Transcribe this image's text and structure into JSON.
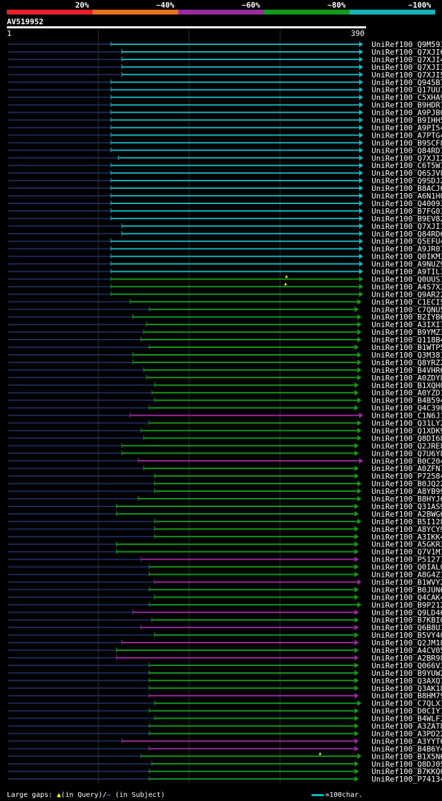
{
  "identity_scale": {
    "bins": [
      {
        "label": "20%",
        "color": "#e8202a"
      },
      {
        "label": "~40%",
        "color": "#e8721c"
      },
      {
        "label": "~60%",
        "color": "#9a2aa0"
      },
      {
        "label": "~80%",
        "color": "#149a1a"
      },
      {
        "label": "~100%",
        "color": "#16b4bc"
      }
    ]
  },
  "query": {
    "id": "AV519952",
    "start_label": "1",
    "end_label": "390",
    "length": 390
  },
  "legend": {
    "prefix": "Large gaps:",
    "query_marker": "▲",
    "in_query": "(in Query)/",
    "subject_marker": "—",
    "in_subject": " (in Subject)",
    "unit": "=100char."
  },
  "chart_data": {
    "type": "alignment",
    "x_axis": {
      "min": 1,
      "max": 390
    },
    "hits": [
      {
        "name": "UniRef100_Q9M591",
        "start": 114,
        "end": 390,
        "color": "#16b4bc"
      },
      {
        "name": "UniRef100_Q7XJI6",
        "start": 126,
        "end": 390,
        "color": "#16b4bc"
      },
      {
        "name": "UniRef100_Q7XJI4",
        "start": 126,
        "end": 390,
        "color": "#16b4bc"
      },
      {
        "name": "UniRef100_Q7XJI3",
        "start": 126,
        "end": 390,
        "color": "#16b4bc"
      },
      {
        "name": "UniRef100_Q7XJI5",
        "start": 126,
        "end": 390,
        "color": "#16b4bc"
      },
      {
        "name": "UniRef100_Q945B7",
        "start": 114,
        "end": 390,
        "color": "#16b4bc"
      },
      {
        "name": "UniRef100_Q17UU7",
        "start": 114,
        "end": 390,
        "color": "#16b4bc"
      },
      {
        "name": "UniRef100_C5XHA9",
        "start": 114,
        "end": 390,
        "color": "#16b4bc"
      },
      {
        "name": "UniRef100_B9HDR7",
        "start": 114,
        "end": 390,
        "color": "#16b4bc"
      },
      {
        "name": "UniRef100_A9PJB0",
        "start": 114,
        "end": 390,
        "color": "#16b4bc"
      },
      {
        "name": "UniRef100_B9IHH5",
        "start": 114,
        "end": 390,
        "color": "#16b4bc"
      },
      {
        "name": "UniRef100_A9PI54",
        "start": 114,
        "end": 390,
        "color": "#16b4bc"
      },
      {
        "name": "UniRef100_A7PTG4",
        "start": 114,
        "end": 390,
        "color": "#16b4bc"
      },
      {
        "name": "UniRef100_B9SCF8",
        "start": 114,
        "end": 390,
        "color": "#16b4bc"
      },
      {
        "name": "UniRef100_Q84RD7",
        "start": 114,
        "end": 390,
        "color": "#16b4bc"
      },
      {
        "name": "UniRef100_Q7XJI2",
        "start": 122,
        "end": 390,
        "color": "#16b4bc"
      },
      {
        "name": "UniRef100_C6T5W1",
        "start": 114,
        "end": 390,
        "color": "#16b4bc"
      },
      {
        "name": "UniRef100_Q6SJV8",
        "start": 114,
        "end": 390,
        "color": "#16b4bc"
      },
      {
        "name": "UniRef100_Q9SDJ2",
        "start": 114,
        "end": 390,
        "color": "#16b4bc"
      },
      {
        "name": "UniRef100_B8ACJ6",
        "start": 114,
        "end": 390,
        "color": "#16b4bc"
      },
      {
        "name": "UniRef100_A6N1H0",
        "start": 114,
        "end": 390,
        "color": "#16b4bc"
      },
      {
        "name": "UniRef100_Q40093",
        "start": 114,
        "end": 390,
        "color": "#16b4bc"
      },
      {
        "name": "UniRef100_B7FG03",
        "start": 114,
        "end": 390,
        "color": "#16b4bc"
      },
      {
        "name": "UniRef100_B9EV82",
        "start": 114,
        "end": 390,
        "color": "#16b4bc"
      },
      {
        "name": "UniRef100_Q7XJI1",
        "start": 126,
        "end": 390,
        "color": "#16b4bc"
      },
      {
        "name": "UniRef100_Q84RD6",
        "start": 126,
        "end": 390,
        "color": "#16b4bc"
      },
      {
        "name": "UniRef100_Q5EFU4",
        "start": 114,
        "end": 390,
        "color": "#16b4bc"
      },
      {
        "name": "UniRef100_A9JR07",
        "start": 114,
        "end": 390,
        "color": "#16b4bc"
      },
      {
        "name": "UniRef100_Q0IKM3",
        "start": 114,
        "end": 390,
        "color": "#16b4bc"
      },
      {
        "name": "UniRef100_A9NUZ9",
        "start": 114,
        "end": 390,
        "color": "#16b4bc"
      },
      {
        "name": "UniRef100_A9TIL3",
        "start": 114,
        "end": 390,
        "color": "#16b4bc"
      },
      {
        "name": "UniRef100_Q0UUS7",
        "start": 114,
        "end": 390,
        "color": "#149a1a"
      },
      {
        "name": "UniRef100_A4S7X3",
        "start": 114,
        "end": 390,
        "color": "#149a1a"
      },
      {
        "name": "UniRef100_Q9AR22",
        "start": 114,
        "end": 390,
        "color": "#149a1a"
      },
      {
        "name": "UniRef100_C1ECI5",
        "start": 135,
        "end": 388,
        "color": "#149a1a"
      },
      {
        "name": "UniRef100_C7QNU5",
        "start": 156,
        "end": 385,
        "color": "#149a1a"
      },
      {
        "name": "UniRef100_B2IYB6",
        "start": 138,
        "end": 388,
        "color": "#149a1a"
      },
      {
        "name": "UniRef100_A3IXI7",
        "start": 153,
        "end": 388,
        "color": "#149a1a"
      },
      {
        "name": "UniRef100_B9YMZ3",
        "start": 150,
        "end": 388,
        "color": "#149a1a"
      },
      {
        "name": "UniRef100_Q118B4",
        "start": 147,
        "end": 388,
        "color": "#149a1a"
      },
      {
        "name": "UniRef100_B1WTP5",
        "start": 156,
        "end": 385,
        "color": "#149a1a"
      },
      {
        "name": "UniRef100_Q3M381",
        "start": 138,
        "end": 388,
        "color": "#149a1a"
      },
      {
        "name": "UniRef100_Q8YRZ2",
        "start": 138,
        "end": 388,
        "color": "#149a1a"
      },
      {
        "name": "UniRef100_B4VHR6",
        "start": 150,
        "end": 388,
        "color": "#149a1a"
      },
      {
        "name": "UniRef100_A0ZDY8",
        "start": 153,
        "end": 388,
        "color": "#149a1a"
      },
      {
        "name": "UniRef100_B1XQH0",
        "start": 162,
        "end": 385,
        "color": "#149a1a"
      },
      {
        "name": "UniRef100_A0YZD1",
        "start": 159,
        "end": 385,
        "color": "#149a1a"
      },
      {
        "name": "UniRef100_B4B594",
        "start": 162,
        "end": 388,
        "color": "#149a1a"
      },
      {
        "name": "UniRef100_Q4C390",
        "start": 156,
        "end": 385,
        "color": "#149a1a"
      },
      {
        "name": "UniRef100_C1N6J1",
        "start": 135,
        "end": 390,
        "color": "#9a2aa0"
      },
      {
        "name": "UniRef100_Q31LY2",
        "start": 156,
        "end": 388,
        "color": "#149a1a"
      },
      {
        "name": "UniRef100_Q1XDK9",
        "start": 147,
        "end": 388,
        "color": "#149a1a"
      },
      {
        "name": "UniRef100_Q8DI68",
        "start": 150,
        "end": 388,
        "color": "#149a1a"
      },
      {
        "name": "UniRef100_Q2JRE8",
        "start": 126,
        "end": 385,
        "color": "#149a1a"
      },
      {
        "name": "UniRef100_Q7U6Y8",
        "start": 126,
        "end": 385,
        "color": "#149a1a"
      },
      {
        "name": "UniRef100_B0C204",
        "start": 144,
        "end": 390,
        "color": "#9a2aa0"
      },
      {
        "name": "UniRef100_A0ZFN7",
        "start": 150,
        "end": 385,
        "color": "#149a1a"
      },
      {
        "name": "UniRef100_P72584",
        "start": 162,
        "end": 385,
        "color": "#149a1a"
      },
      {
        "name": "UniRef100_B0JQ22",
        "start": 162,
        "end": 388,
        "color": "#149a1a"
      },
      {
        "name": "UniRef100_A8YB99",
        "start": 162,
        "end": 388,
        "color": "#149a1a"
      },
      {
        "name": "UniRef100_B8HYJ6",
        "start": 144,
        "end": 388,
        "color": "#149a1a"
      },
      {
        "name": "UniRef100_Q31AS9",
        "start": 120,
        "end": 385,
        "color": "#149a1a"
      },
      {
        "name": "UniRef100_A2BWG6",
        "start": 120,
        "end": 385,
        "color": "#149a1a"
      },
      {
        "name": "UniRef100_B5I128",
        "start": 162,
        "end": 388,
        "color": "#149a1a"
      },
      {
        "name": "UniRef100_A8YCY9",
        "start": 162,
        "end": 385,
        "color": "#149a1a"
      },
      {
        "name": "UniRef100_A3IKK4",
        "start": 162,
        "end": 385,
        "color": "#149a1a"
      },
      {
        "name": "UniRef100_A5GKR3",
        "start": 120,
        "end": 385,
        "color": "#149a1a"
      },
      {
        "name": "UniRef100_Q7V1M1",
        "start": 120,
        "end": 385,
        "color": "#149a1a"
      },
      {
        "name": "UniRef100_P51277",
        "start": 147,
        "end": 385,
        "color": "#9a2aa0"
      },
      {
        "name": "UniRef100_Q0IAL0",
        "start": 156,
        "end": 385,
        "color": "#149a1a"
      },
      {
        "name": "UniRef100_A8G4Z1",
        "start": 156,
        "end": 385,
        "color": "#149a1a"
      },
      {
        "name": "UniRef100_B1WVY2",
        "start": 162,
        "end": 388,
        "color": "#9a2aa0"
      },
      {
        "name": "UniRef100_B0JUN6",
        "start": 156,
        "end": 385,
        "color": "#149a1a"
      },
      {
        "name": "UniRef100_Q4CAK4",
        "start": 162,
        "end": 385,
        "color": "#149a1a"
      },
      {
        "name": "UniRef100_B9P212",
        "start": 156,
        "end": 388,
        "color": "#149a1a"
      },
      {
        "name": "UniRef100_Q9LD46",
        "start": 138,
        "end": 385,
        "color": "#9a2aa0"
      },
      {
        "name": "UniRef100_B7KBI0",
        "start": 159,
        "end": 385,
        "color": "#149a1a"
      },
      {
        "name": "UniRef100_Q6B8U1",
        "start": 147,
        "end": 385,
        "color": "#9a2aa0"
      },
      {
        "name": "UniRef100_B5VY40",
        "start": 162,
        "end": 385,
        "color": "#149a1a"
      },
      {
        "name": "UniRef100_Q2JM18",
        "start": 126,
        "end": 385,
        "color": "#9a2aa0"
      },
      {
        "name": "UniRef100_A4CV05",
        "start": 120,
        "end": 385,
        "color": "#149a1a"
      },
      {
        "name": "UniRef100_A2BR98",
        "start": 120,
        "end": 385,
        "color": "#9a2aa0"
      },
      {
        "name": "UniRef100_Q066V3",
        "start": 156,
        "end": 385,
        "color": "#149a1a"
      },
      {
        "name": "UniRef100_B9YUW2",
        "start": 156,
        "end": 385,
        "color": "#149a1a"
      },
      {
        "name": "UniRef100_Q3AXQ7",
        "start": 156,
        "end": 385,
        "color": "#149a1a"
      },
      {
        "name": "UniRef100_Q3AK18",
        "start": 156,
        "end": 385,
        "color": "#149a1a"
      },
      {
        "name": "UniRef100_B8HM79",
        "start": 156,
        "end": 385,
        "color": "#9a2aa0"
      },
      {
        "name": "UniRef100_C7QLX1",
        "start": 162,
        "end": 388,
        "color": "#149a1a"
      },
      {
        "name": "UniRef100_D0CIY7",
        "start": 156,
        "end": 385,
        "color": "#149a1a"
      },
      {
        "name": "UniRef100_B4WLF3",
        "start": 162,
        "end": 385,
        "color": "#149a1a"
      },
      {
        "name": "UniRef100_A3ZAT8",
        "start": 156,
        "end": 385,
        "color": "#149a1a"
      },
      {
        "name": "UniRef100_A3PD22",
        "start": 156,
        "end": 385,
        "color": "#149a1a"
      },
      {
        "name": "UniRef100_A3YYT6",
        "start": 126,
        "end": 385,
        "color": "#9a2aa0"
      },
      {
        "name": "UniRef100_B4B6Y4",
        "start": 156,
        "end": 385,
        "color": "#9a2aa0"
      },
      {
        "name": "UniRef100_B1X5N6",
        "start": 147,
        "end": 388,
        "color": "#149a1a"
      },
      {
        "name": "UniRef100_Q8DJ05",
        "start": 159,
        "end": 385,
        "color": "#149a1a"
      },
      {
        "name": "UniRef100_B7KKQ0",
        "start": 156,
        "end": 385,
        "color": "#149a1a"
      },
      {
        "name": "UniRef100_P74134",
        "start": 156,
        "end": 385,
        "color": "#149a1a"
      }
    ],
    "query_gaps": [
      {
        "hit": "UniRef100_Q0UUS7",
        "position": 307
      },
      {
        "hit": "UniRef100_A4S7X3",
        "position": 306
      },
      {
        "hit": "UniRef100_B1X5N6",
        "position": 344
      }
    ]
  }
}
